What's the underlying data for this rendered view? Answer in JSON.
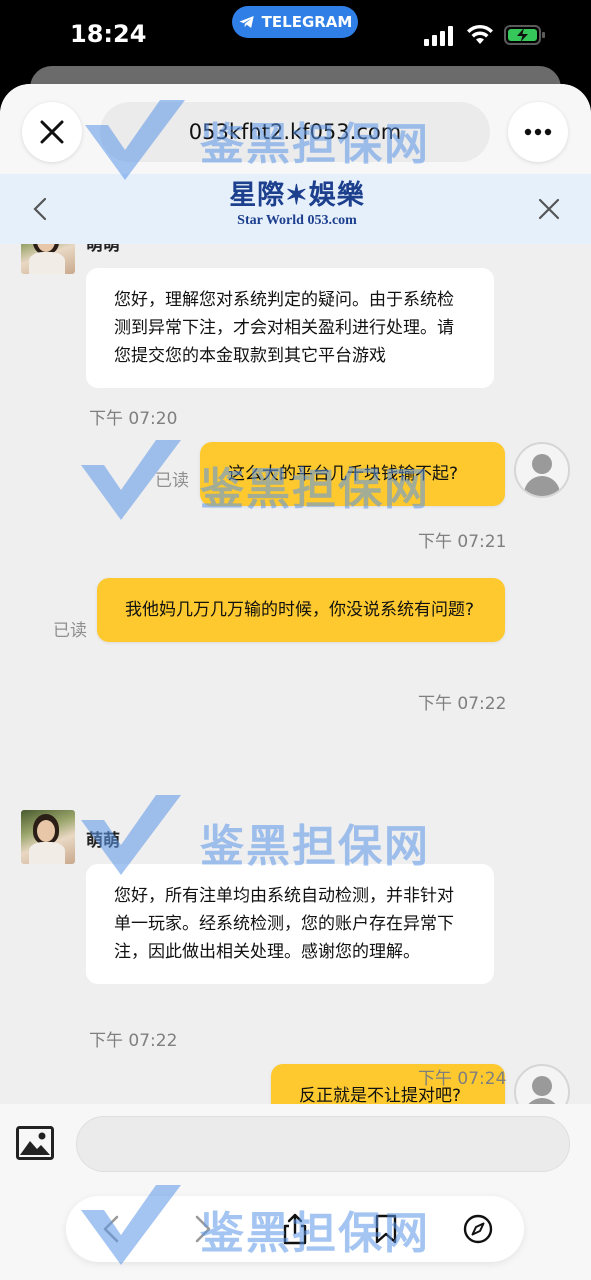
{
  "status_bar": {
    "time": "18:24",
    "telegram_label": "TELEGRAM"
  },
  "browser": {
    "url": "053kfht2.kf053.com"
  },
  "site": {
    "logo_cn": "星際✶娛樂",
    "logo_en": "Star World 053.com"
  },
  "chat": {
    "agent_name": "萌萌",
    "messages": [
      {
        "id": "m1",
        "side": "in",
        "text": "您好，理解您对系统判定的疑问。由于系统检测到异常下注，才会对相关盈利进行处理。请您提交您的本金取款到其它平台游戏",
        "time": "下午 07:20"
      },
      {
        "id": "m2",
        "side": "out",
        "text": "这么大的平台几千块钱输不起?",
        "time": "下午 07:21",
        "status": "已读"
      },
      {
        "id": "m3",
        "side": "out",
        "text": "我他妈几万几万输的时候，你没说系统有问题?",
        "time": "下午 07:22",
        "status": "已读"
      },
      {
        "id": "m4",
        "side": "in",
        "text": "您好，所有注单均由系统自动检测，并非针对单一玩家。经系统检测，您的账户存在异常下注，因此做出相关处理。感谢您的理解。",
        "time": "下午 07:22"
      },
      {
        "id": "m5",
        "side": "out",
        "text": "反正就是不让提对吧?",
        "time": "下午 07:24"
      }
    ]
  },
  "input": {
    "value": ""
  },
  "watermark": {
    "text": "鉴黑担保网",
    "color": "#5b95e8"
  },
  "colors": {
    "outgoing_bubble": "#fdc92e",
    "incoming_bubble": "#ffffff",
    "brand": "#1c3f8e",
    "telegram": "#2f7fe6"
  },
  "icons": {
    "browser": [
      "close-icon",
      "more-icon"
    ],
    "header": [
      "chevron-left-icon",
      "close-icon"
    ],
    "toolbar": [
      "back-icon",
      "forward-icon",
      "share-icon",
      "bookmark-icon",
      "compass-icon"
    ],
    "input": [
      "image-icon"
    ]
  }
}
